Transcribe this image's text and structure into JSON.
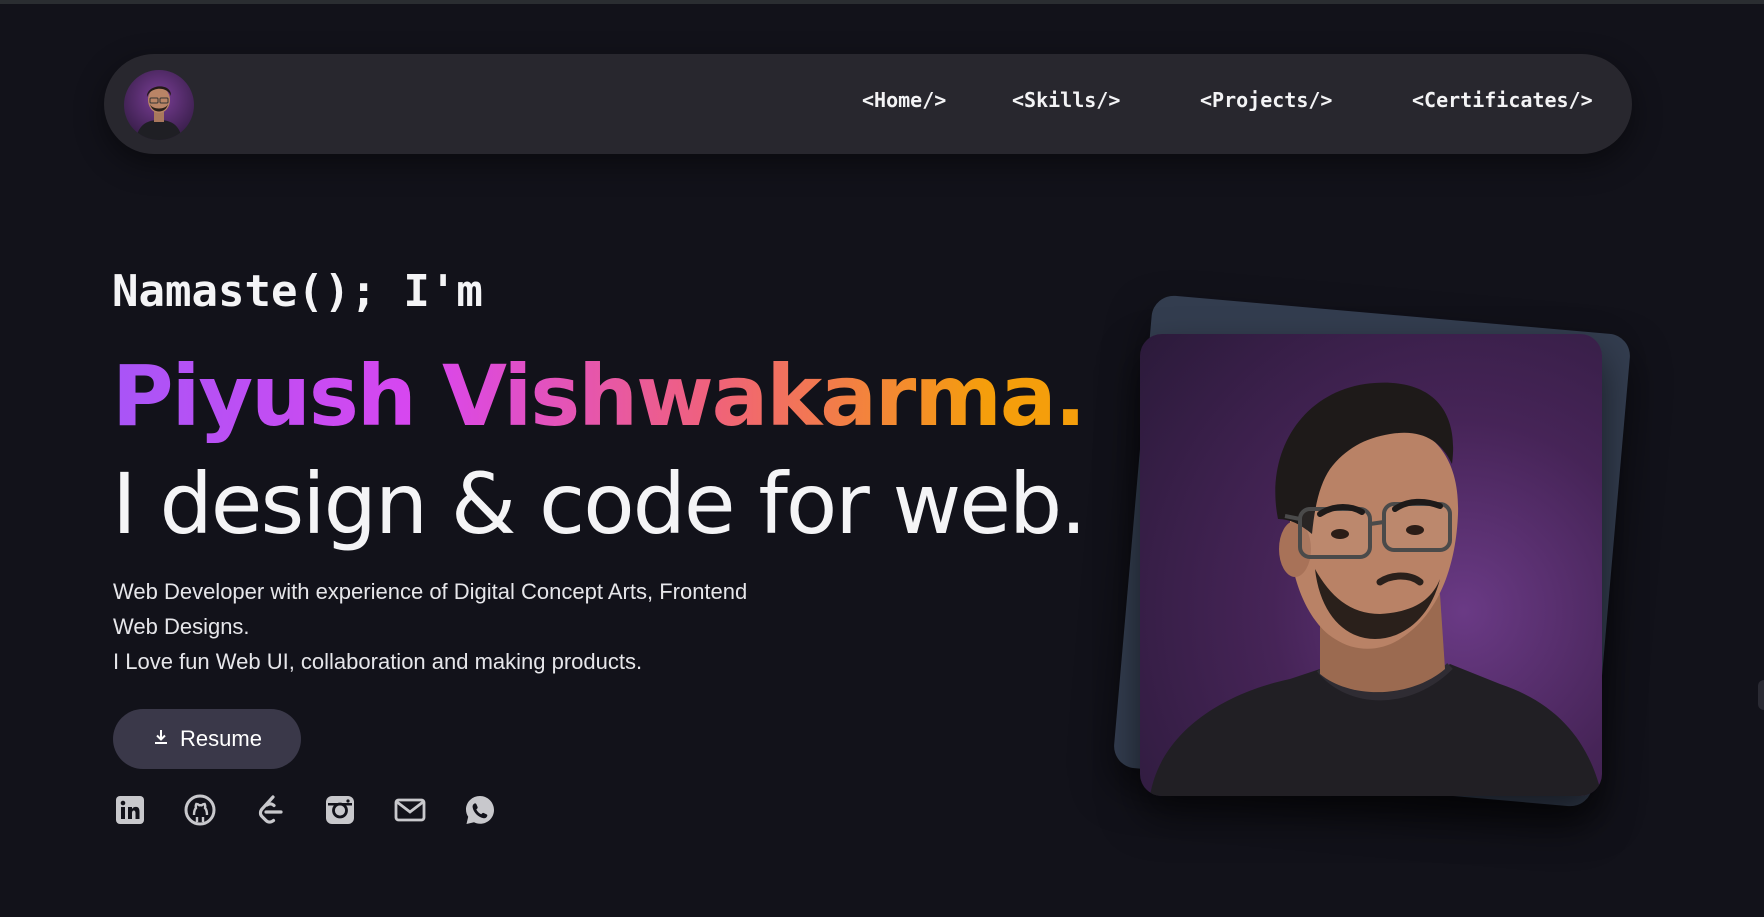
{
  "nav": {
    "avatar_alt": "profile avatar",
    "links": [
      "<Home/>",
      "<Skills/>",
      "<Projects/>",
      "<Certificates/>"
    ]
  },
  "hero": {
    "greeting": "Namaste(); I'm",
    "name": "Piyush Vishwakarma.",
    "tagline": "I design & code for web.",
    "description": [
      "Web Developer with experience of Digital Concept Arts, Frontend",
      "Web Designs.",
      "I Love fun Web UI, collaboration and making products."
    ],
    "resume_label": "Resume"
  },
  "socials": [
    {
      "name": "linkedin-icon"
    },
    {
      "name": "github-icon"
    },
    {
      "name": "leetcode-icon"
    },
    {
      "name": "instagram-icon"
    },
    {
      "name": "mail-icon"
    },
    {
      "name": "whatsapp-icon"
    }
  ],
  "colors": {
    "background": "#12121a",
    "nav_bg": "#28272e",
    "button_bg": "#3a3849",
    "gradient": [
      "#a855f7",
      "#d946ef",
      "#f0627a",
      "#f59e0b"
    ],
    "photo_frame": "#333d4f"
  }
}
